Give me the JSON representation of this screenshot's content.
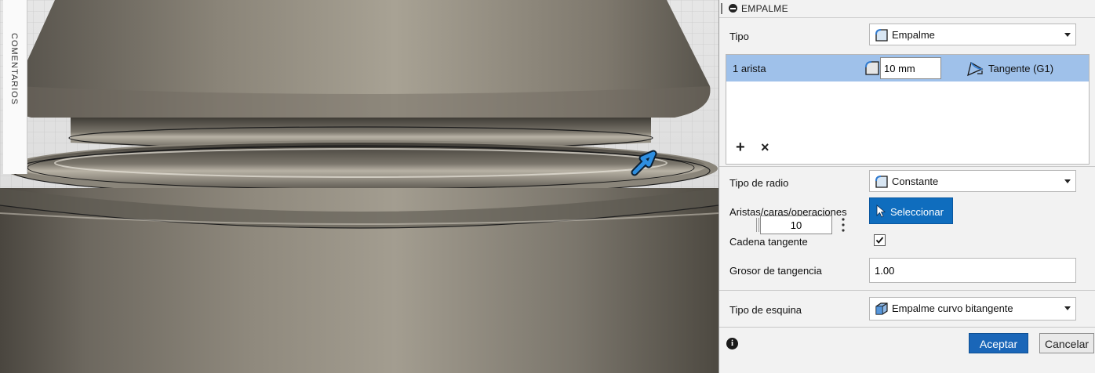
{
  "viewport": {
    "side_tab_label": "COMENTARIOS"
  },
  "panel": {
    "title": "EMPALME",
    "tipo": {
      "label": "Tipo",
      "value": "Empalme",
      "icon": "fillet-icon"
    },
    "edges": {
      "rows": [
        {
          "name": "1 arista",
          "radius": "10 mm",
          "continuity": "Tangente (G1)"
        }
      ],
      "add_icon": "+",
      "remove_icon": "×"
    },
    "tipo_radio": {
      "label": "Tipo de radio",
      "value": "Constante"
    },
    "aristas": {
      "label": "Aristas/caras/operaciones",
      "button_label": "Seleccionar",
      "stepper_value": "10"
    },
    "cadena_tangente": {
      "label": "Cadena tangente",
      "checked": true
    },
    "grosor": {
      "label": "Grosor de tangencia",
      "value": "1.00"
    },
    "tipo_esquina": {
      "label": "Tipo de esquina",
      "value": "Empalme curvo bitangente"
    },
    "footer": {
      "ok_label": "Aceptar",
      "cancel_label": "Cancelar",
      "info_icon": "i"
    }
  }
}
